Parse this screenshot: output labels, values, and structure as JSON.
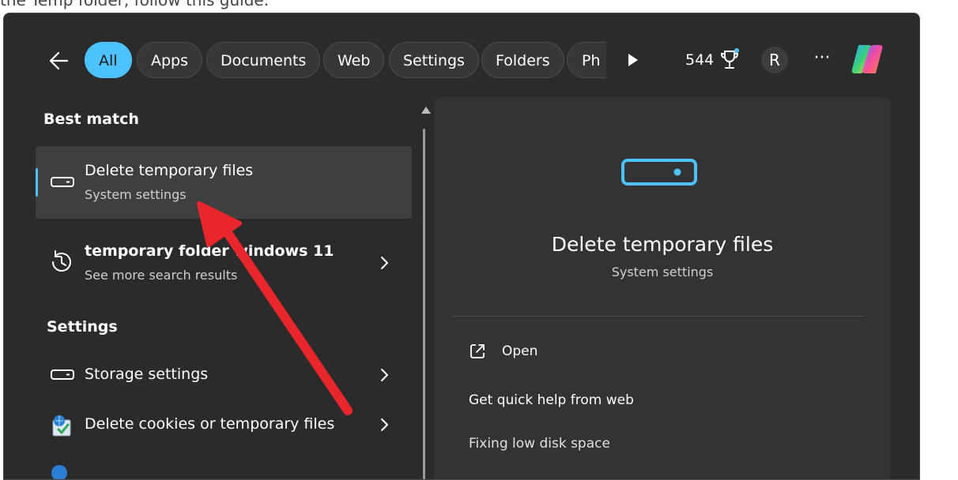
{
  "background_text": "the Temp folder, follow this guide.",
  "filters": {
    "tabs": [
      {
        "label": "All"
      },
      {
        "label": "Apps"
      },
      {
        "label": "Documents"
      },
      {
        "label": "Web"
      },
      {
        "label": "Settings"
      },
      {
        "label": "Folders"
      },
      {
        "label": "Ph"
      }
    ]
  },
  "header": {
    "points": "544",
    "avatar_initial": "R",
    "more_label": "···"
  },
  "results": {
    "best_match_title": "Best match",
    "best_match": {
      "title": "Delete temporary files",
      "subtitle": "System settings"
    },
    "web_search": {
      "title": "temporary folder windows 11",
      "subtitle": "See more search results"
    },
    "settings_title": "Settings",
    "settings_items": [
      {
        "title": "Storage settings"
      },
      {
        "title": "Delete cookies or temporary files"
      }
    ]
  },
  "detail": {
    "title": "Delete temporary files",
    "subtitle": "System settings",
    "actions": [
      {
        "label": "Open"
      },
      {
        "label": "Get quick help from web"
      },
      {
        "label": "Fixing low disk space"
      }
    ]
  },
  "colors": {
    "accent": "#4cc2ff",
    "window_bg": "#2b2b2b",
    "annotation_arrow": "#e8262b"
  },
  "icons": {
    "back": "arrow-left-icon",
    "play": "play-icon",
    "trophy": "trophy-icon",
    "more": "more-icon",
    "copilot": "copilot-icon",
    "storage": "storage-drive-icon",
    "history": "history-icon",
    "chevron": "chevron-right-icon",
    "open": "open-external-icon"
  }
}
